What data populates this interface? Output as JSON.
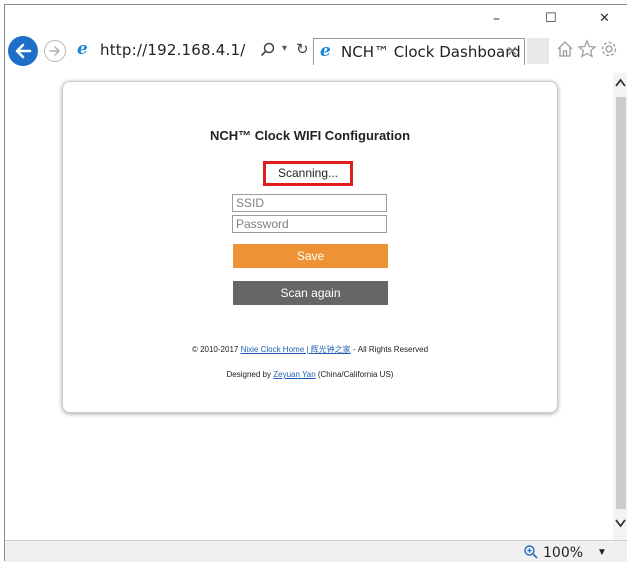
{
  "window": {
    "minimize_glyph": "–",
    "maximize_glyph": "☐",
    "close_glyph": "✕"
  },
  "toolbar": {
    "url": "http://192.168.4.1/",
    "tab_title": "NCH™ Clock Dashboard",
    "tab_close_glyph": "✕",
    "dropdown_glyph": "▾",
    "refresh_glyph": "↻"
  },
  "page": {
    "title": "NCH™ Clock WIFI Configuration",
    "status_text": "Scanning...",
    "ssid_placeholder": "SSID",
    "password_placeholder": "Password",
    "save_label": "Save",
    "scan_again_label": "Scan again",
    "footer_copyright_prefix": "© 2010-2017 ",
    "footer_copyright_link": "Nixie Clock Home | 辉光钟之家",
    "footer_copyright_suffix": " - All Rights Reserved",
    "footer_designed_prefix": "Designed by ",
    "footer_designed_link": "Zeyuan Yan",
    "footer_designed_suffix": " (China/California US)"
  },
  "statusbar": {
    "zoom": "100%",
    "zoom_dropdown_glyph": "▼"
  },
  "colors": {
    "back_button": "#1e6fc9",
    "save_button": "#ee9236",
    "scan_button": "#666666",
    "highlight_border": "#e21b1b",
    "link": "#1f5fb3"
  }
}
